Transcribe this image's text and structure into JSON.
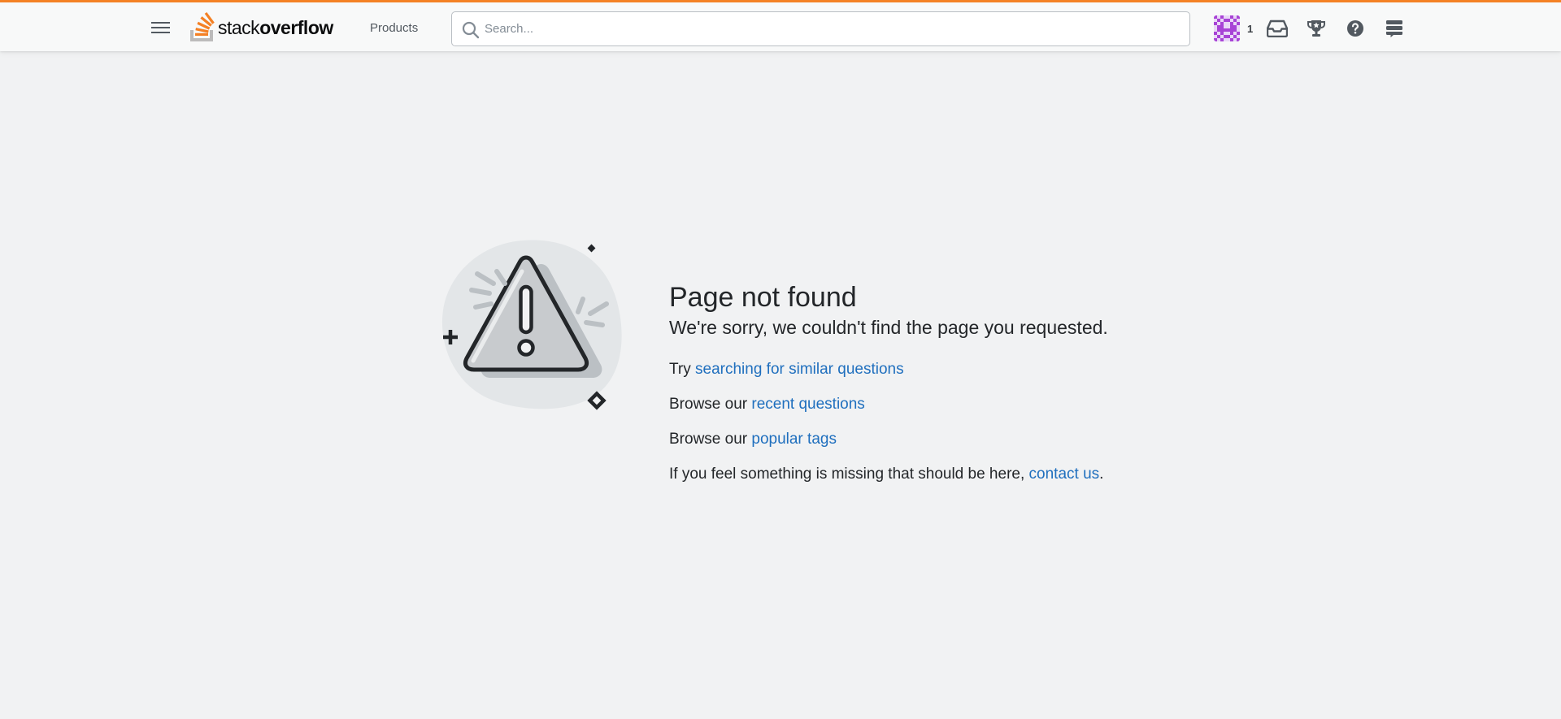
{
  "header": {
    "menu_label": "Menu",
    "logo": {
      "text_light": "stack",
      "text_bold": "overflow",
      "brand_color": "#f48225"
    },
    "products_label": "Products",
    "search": {
      "placeholder": "Search...",
      "value": ""
    },
    "user": {
      "reputation": "1"
    },
    "icons": [
      "inbox-icon",
      "achievements-icon",
      "help-icon",
      "site-switcher-icon"
    ]
  },
  "error_page": {
    "title": "Page not found",
    "subtitle": "We're sorry, we couldn't find the page you requested.",
    "lines": [
      {
        "prefix": "Try ",
        "link": "searching for similar questions",
        "suffix": ""
      },
      {
        "prefix": "Browse our ",
        "link": "recent questions",
        "suffix": ""
      },
      {
        "prefix": "Browse our ",
        "link": "popular tags",
        "suffix": ""
      },
      {
        "prefix": "If you feel something is missing that should be here, ",
        "link": "contact us",
        "suffix": "."
      }
    ]
  },
  "colors": {
    "accent": "#f48225",
    "link": "#1f6fbe",
    "background": "#f1f2f3",
    "text": "#232629"
  }
}
